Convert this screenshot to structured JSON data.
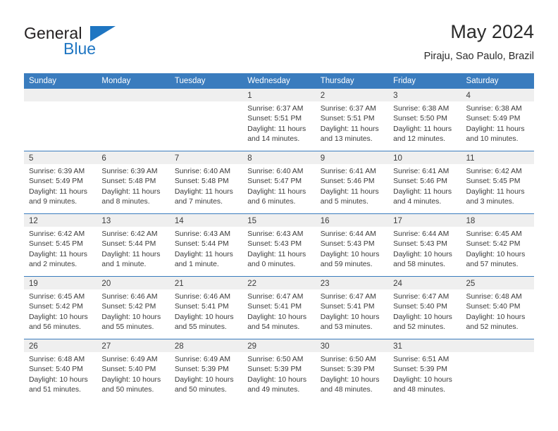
{
  "brand": {
    "name_part1": "General",
    "name_part2": "Blue",
    "mark": "triangle-mark",
    "accent_color": "#1f76c2"
  },
  "header": {
    "title": "May 2024",
    "subtitle": "Piraju, Sao Paulo, Brazil"
  },
  "calendar": {
    "header_color": "#3a7cbe",
    "daynum_band_color": "#efefef",
    "weekdays": [
      "Sunday",
      "Monday",
      "Tuesday",
      "Wednesday",
      "Thursday",
      "Friday",
      "Saturday"
    ],
    "weeks": [
      [
        {
          "day": "",
          "lines": []
        },
        {
          "day": "",
          "lines": []
        },
        {
          "day": "",
          "lines": []
        },
        {
          "day": "1",
          "lines": [
            "Sunrise: 6:37 AM",
            "Sunset: 5:51 PM",
            "Daylight: 11 hours",
            "and 14 minutes."
          ]
        },
        {
          "day": "2",
          "lines": [
            "Sunrise: 6:37 AM",
            "Sunset: 5:51 PM",
            "Daylight: 11 hours",
            "and 13 minutes."
          ]
        },
        {
          "day": "3",
          "lines": [
            "Sunrise: 6:38 AM",
            "Sunset: 5:50 PM",
            "Daylight: 11 hours",
            "and 12 minutes."
          ]
        },
        {
          "day": "4",
          "lines": [
            "Sunrise: 6:38 AM",
            "Sunset: 5:49 PM",
            "Daylight: 11 hours",
            "and 10 minutes."
          ]
        }
      ],
      [
        {
          "day": "5",
          "lines": [
            "Sunrise: 6:39 AM",
            "Sunset: 5:49 PM",
            "Daylight: 11 hours",
            "and 9 minutes."
          ]
        },
        {
          "day": "6",
          "lines": [
            "Sunrise: 6:39 AM",
            "Sunset: 5:48 PM",
            "Daylight: 11 hours",
            "and 8 minutes."
          ]
        },
        {
          "day": "7",
          "lines": [
            "Sunrise: 6:40 AM",
            "Sunset: 5:48 PM",
            "Daylight: 11 hours",
            "and 7 minutes."
          ]
        },
        {
          "day": "8",
          "lines": [
            "Sunrise: 6:40 AM",
            "Sunset: 5:47 PM",
            "Daylight: 11 hours",
            "and 6 minutes."
          ]
        },
        {
          "day": "9",
          "lines": [
            "Sunrise: 6:41 AM",
            "Sunset: 5:46 PM",
            "Daylight: 11 hours",
            "and 5 minutes."
          ]
        },
        {
          "day": "10",
          "lines": [
            "Sunrise: 6:41 AM",
            "Sunset: 5:46 PM",
            "Daylight: 11 hours",
            "and 4 minutes."
          ]
        },
        {
          "day": "11",
          "lines": [
            "Sunrise: 6:42 AM",
            "Sunset: 5:45 PM",
            "Daylight: 11 hours",
            "and 3 minutes."
          ]
        }
      ],
      [
        {
          "day": "12",
          "lines": [
            "Sunrise: 6:42 AM",
            "Sunset: 5:45 PM",
            "Daylight: 11 hours",
            "and 2 minutes."
          ]
        },
        {
          "day": "13",
          "lines": [
            "Sunrise: 6:42 AM",
            "Sunset: 5:44 PM",
            "Daylight: 11 hours",
            "and 1 minute."
          ]
        },
        {
          "day": "14",
          "lines": [
            "Sunrise: 6:43 AM",
            "Sunset: 5:44 PM",
            "Daylight: 11 hours",
            "and 1 minute."
          ]
        },
        {
          "day": "15",
          "lines": [
            "Sunrise: 6:43 AM",
            "Sunset: 5:43 PM",
            "Daylight: 11 hours",
            "and 0 minutes."
          ]
        },
        {
          "day": "16",
          "lines": [
            "Sunrise: 6:44 AM",
            "Sunset: 5:43 PM",
            "Daylight: 10 hours",
            "and 59 minutes."
          ]
        },
        {
          "day": "17",
          "lines": [
            "Sunrise: 6:44 AM",
            "Sunset: 5:43 PM",
            "Daylight: 10 hours",
            "and 58 minutes."
          ]
        },
        {
          "day": "18",
          "lines": [
            "Sunrise: 6:45 AM",
            "Sunset: 5:42 PM",
            "Daylight: 10 hours",
            "and 57 minutes."
          ]
        }
      ],
      [
        {
          "day": "19",
          "lines": [
            "Sunrise: 6:45 AM",
            "Sunset: 5:42 PM",
            "Daylight: 10 hours",
            "and 56 minutes."
          ]
        },
        {
          "day": "20",
          "lines": [
            "Sunrise: 6:46 AM",
            "Sunset: 5:42 PM",
            "Daylight: 10 hours",
            "and 55 minutes."
          ]
        },
        {
          "day": "21",
          "lines": [
            "Sunrise: 6:46 AM",
            "Sunset: 5:41 PM",
            "Daylight: 10 hours",
            "and 55 minutes."
          ]
        },
        {
          "day": "22",
          "lines": [
            "Sunrise: 6:47 AM",
            "Sunset: 5:41 PM",
            "Daylight: 10 hours",
            "and 54 minutes."
          ]
        },
        {
          "day": "23",
          "lines": [
            "Sunrise: 6:47 AM",
            "Sunset: 5:41 PM",
            "Daylight: 10 hours",
            "and 53 minutes."
          ]
        },
        {
          "day": "24",
          "lines": [
            "Sunrise: 6:47 AM",
            "Sunset: 5:40 PM",
            "Daylight: 10 hours",
            "and 52 minutes."
          ]
        },
        {
          "day": "25",
          "lines": [
            "Sunrise: 6:48 AM",
            "Sunset: 5:40 PM",
            "Daylight: 10 hours",
            "and 52 minutes."
          ]
        }
      ],
      [
        {
          "day": "26",
          "lines": [
            "Sunrise: 6:48 AM",
            "Sunset: 5:40 PM",
            "Daylight: 10 hours",
            "and 51 minutes."
          ]
        },
        {
          "day": "27",
          "lines": [
            "Sunrise: 6:49 AM",
            "Sunset: 5:40 PM",
            "Daylight: 10 hours",
            "and 50 minutes."
          ]
        },
        {
          "day": "28",
          "lines": [
            "Sunrise: 6:49 AM",
            "Sunset: 5:39 PM",
            "Daylight: 10 hours",
            "and 50 minutes."
          ]
        },
        {
          "day": "29",
          "lines": [
            "Sunrise: 6:50 AM",
            "Sunset: 5:39 PM",
            "Daylight: 10 hours",
            "and 49 minutes."
          ]
        },
        {
          "day": "30",
          "lines": [
            "Sunrise: 6:50 AM",
            "Sunset: 5:39 PM",
            "Daylight: 10 hours",
            "and 48 minutes."
          ]
        },
        {
          "day": "31",
          "lines": [
            "Sunrise: 6:51 AM",
            "Sunset: 5:39 PM",
            "Daylight: 10 hours",
            "and 48 minutes."
          ]
        },
        {
          "day": "",
          "lines": []
        }
      ]
    ]
  }
}
